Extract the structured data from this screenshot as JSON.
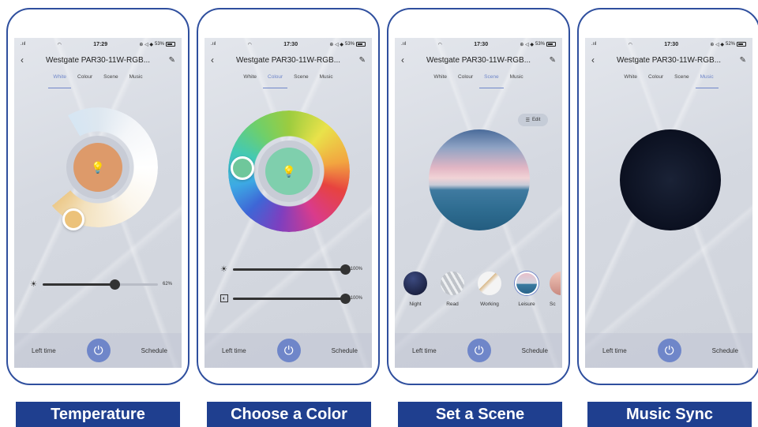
{
  "colors": {
    "accent": "#6f86c9",
    "frame": "#2f4f9e",
    "caption_bg": "#1f3f8f"
  },
  "phones": [
    {
      "status": {
        "signal": ".ııl",
        "wifi": "wifi-icon",
        "time": "17:29",
        "icons": "⊕ ◁ ◆",
        "battery": "53%"
      },
      "title": "Westgate PAR30-11W-RGB...",
      "tabs": [
        "White",
        "Colour",
        "Scene",
        "Music"
      ],
      "active_tab": "White",
      "brightness_value": "62%",
      "brightness_level": 0.62,
      "bottom": {
        "left": "Left time",
        "right": "Schedule"
      },
      "caption": "Temperature"
    },
    {
      "status": {
        "signal": ".ııl",
        "wifi": "wifi-icon",
        "time": "17:30",
        "icons": "⊕ ◁ ◆",
        "battery": "53%"
      },
      "title": "Westgate PAR30-11W-RGB...",
      "tabs": [
        "White",
        "Colour",
        "Scene",
        "Music"
      ],
      "active_tab": "Colour",
      "brightness_value": "100%",
      "saturation_value": "100%",
      "brightness_level": 1.0,
      "saturation_level": 1.0,
      "bottom": {
        "left": "Left time",
        "right": "Schedule"
      },
      "caption": "Choose a Color"
    },
    {
      "status": {
        "signal": ".ııl",
        "wifi": "wifi-icon",
        "time": "17:30",
        "icons": "⊕ ◁ ◆",
        "battery": "53%"
      },
      "title": "Westgate PAR30-11W-RGB...",
      "tabs": [
        "White",
        "Colour",
        "Scene",
        "Music"
      ],
      "active_tab": "Scene",
      "edit_label": "Edit",
      "scenes": [
        "Night",
        "Read",
        "Working",
        "Leisure",
        "Sc"
      ],
      "selected_scene": "Leisure",
      "bottom": {
        "left": "Left time",
        "right": "Schedule"
      },
      "caption": "Set a Scene"
    },
    {
      "status": {
        "signal": ".ııl",
        "wifi": "wifi-icon",
        "time": "17:30",
        "icons": "⊕ ◁ ◆",
        "battery": "52%"
      },
      "title": "Westgate PAR30-11W-RGB...",
      "tabs": [
        "White",
        "Colour",
        "Scene",
        "Music"
      ],
      "active_tab": "Music",
      "bottom": {
        "left": "Left time",
        "right": "Schedule"
      },
      "caption": "Music Sync"
    }
  ]
}
